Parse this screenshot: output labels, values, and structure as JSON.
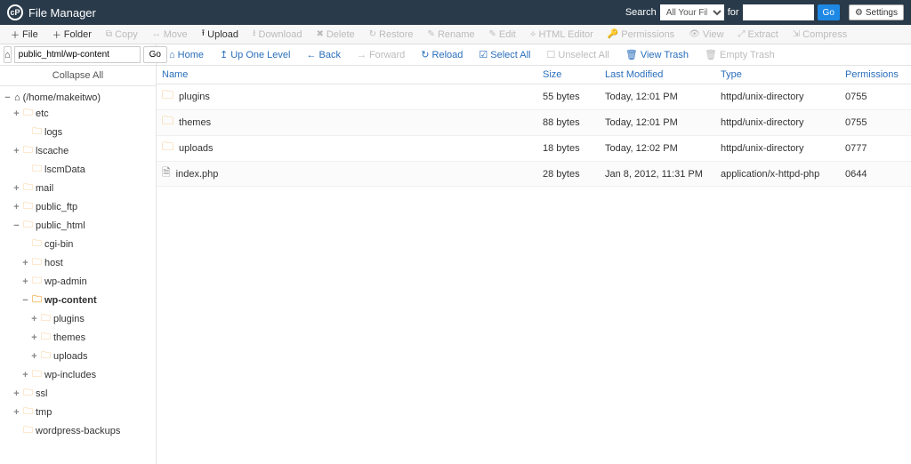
{
  "header": {
    "app_title": "File Manager",
    "search_label": "Search",
    "scope_value": "All Your Files",
    "for_label": "for",
    "search_value": "",
    "go_label": "Go",
    "settings_label": "Settings"
  },
  "toolbar": {
    "items": [
      {
        "icon": "＋",
        "label": "File",
        "enabled": true
      },
      {
        "icon": "＋",
        "label": "Folder",
        "enabled": true
      },
      {
        "icon": "⧉",
        "label": "Copy",
        "enabled": false
      },
      {
        "icon": "↔",
        "label": "Move",
        "enabled": false
      },
      {
        "icon": "⭱",
        "label": "Upload",
        "enabled": true
      },
      {
        "icon": "⭳",
        "label": "Download",
        "enabled": false
      },
      {
        "icon": "✖",
        "label": "Delete",
        "enabled": false
      },
      {
        "icon": "↻",
        "label": "Restore",
        "enabled": false
      },
      {
        "icon": "✎",
        "label": "Rename",
        "enabled": false
      },
      {
        "icon": "✎",
        "label": "Edit",
        "enabled": false
      },
      {
        "icon": "⟡",
        "label": "HTML Editor",
        "enabled": false
      },
      {
        "icon": "🔑",
        "label": "Permissions",
        "enabled": false
      },
      {
        "icon": "👁",
        "label": "View",
        "enabled": false
      },
      {
        "icon": "⤢",
        "label": "Extract",
        "enabled": false
      },
      {
        "icon": "⇲",
        "label": "Compress",
        "enabled": false
      }
    ]
  },
  "location": {
    "path": "public_html/wp-content",
    "go_label": "Go"
  },
  "filenav": {
    "items": [
      {
        "icon": "⌂",
        "label": "Home",
        "state": "link"
      },
      {
        "icon": "↥",
        "label": "Up One Level",
        "state": "link"
      },
      {
        "icon": "←",
        "label": "Back",
        "state": "link"
      },
      {
        "icon": "→",
        "label": "Forward",
        "state": "disabled"
      },
      {
        "icon": "↻",
        "label": "Reload",
        "state": "link"
      },
      {
        "icon": "☑",
        "label": "Select All",
        "state": "link"
      },
      {
        "icon": "☐",
        "label": "Unselect All",
        "state": "disabled"
      },
      {
        "icon": "🗑",
        "label": "View Trash",
        "state": "link"
      },
      {
        "icon": "🗑",
        "label": "Empty Trash",
        "state": "disabled"
      }
    ]
  },
  "sidebar": {
    "collapse_all": "Collapse All",
    "root_label": "(/home/makeitwo)",
    "nodes": [
      {
        "depth": 1,
        "exp": "+",
        "label": "etc",
        "bold": false
      },
      {
        "depth": 2,
        "exp": "",
        "label": "logs",
        "bold": false
      },
      {
        "depth": 1,
        "exp": "+",
        "label": "lscache",
        "bold": false
      },
      {
        "depth": 2,
        "exp": "",
        "label": "lscmData",
        "bold": false
      },
      {
        "depth": 1,
        "exp": "+",
        "label": "mail",
        "bold": false
      },
      {
        "depth": 1,
        "exp": "+",
        "label": "public_ftp",
        "bold": false
      },
      {
        "depth": 1,
        "exp": "−",
        "label": "public_html",
        "bold": false
      },
      {
        "depth": 2,
        "exp": "",
        "label": "cgi-bin",
        "bold": false
      },
      {
        "depth": 2,
        "exp": "+",
        "label": "host",
        "bold": false
      },
      {
        "depth": 2,
        "exp": "+",
        "label": "wp-admin",
        "bold": false
      },
      {
        "depth": 2,
        "exp": "−",
        "label": "wp-content",
        "bold": true
      },
      {
        "depth": 3,
        "exp": "+",
        "label": "plugins",
        "bold": false
      },
      {
        "depth": 3,
        "exp": "+",
        "label": "themes",
        "bold": false
      },
      {
        "depth": 3,
        "exp": "+",
        "label": "uploads",
        "bold": false
      },
      {
        "depth": 2,
        "exp": "+",
        "label": "wp-includes",
        "bold": false
      },
      {
        "depth": 1,
        "exp": "+",
        "label": "ssl",
        "bold": false
      },
      {
        "depth": 1,
        "exp": "+",
        "label": "tmp",
        "bold": false
      },
      {
        "depth": 1,
        "exp": "",
        "label": "wordpress-backups",
        "bold": false
      }
    ]
  },
  "filelist": {
    "headers": {
      "name": "Name",
      "size": "Size",
      "modified": "Last Modified",
      "type": "Type",
      "permissions": "Permissions"
    },
    "rows": [
      {
        "kind": "folder",
        "name": "plugins",
        "size": "55 bytes",
        "modified": "Today, 12:01 PM",
        "type": "httpd/unix-directory",
        "perm": "0755"
      },
      {
        "kind": "folder",
        "name": "themes",
        "size": "88 bytes",
        "modified": "Today, 12:01 PM",
        "type": "httpd/unix-directory",
        "perm": "0755"
      },
      {
        "kind": "folder",
        "name": "uploads",
        "size": "18 bytes",
        "modified": "Today, 12:02 PM",
        "type": "httpd/unix-directory",
        "perm": "0777"
      },
      {
        "kind": "file",
        "name": "index.php",
        "size": "28 bytes",
        "modified": "Jan 8, 2012, 11:31 PM",
        "type": "application/x-httpd-php",
        "perm": "0644"
      }
    ]
  }
}
